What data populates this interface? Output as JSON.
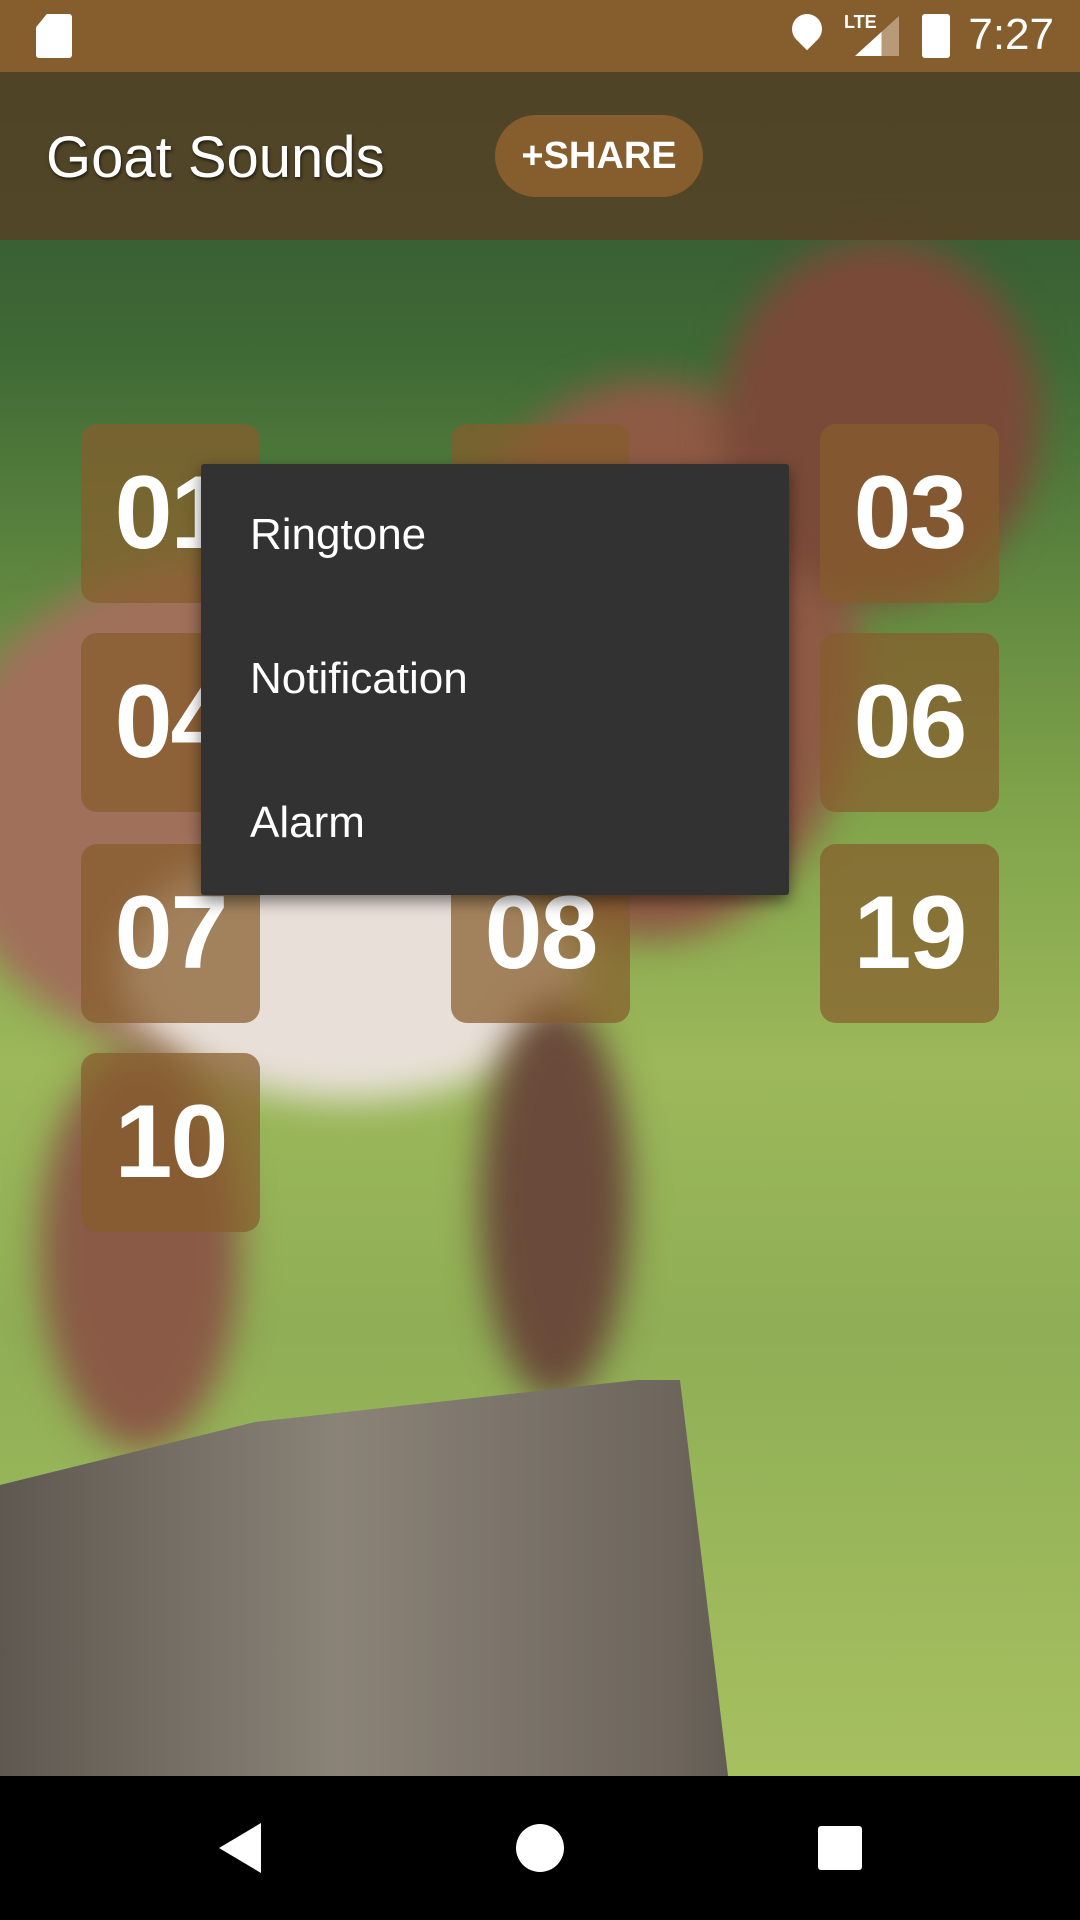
{
  "status_bar": {
    "time": "7:27",
    "network": "LTE",
    "icons": [
      "sd-card-icon",
      "location-icon",
      "lte-signal-icon",
      "battery-charging-icon"
    ],
    "color": "#865d2c"
  },
  "app_bar": {
    "title": "Goat Sounds",
    "share_label": "+SHARE"
  },
  "sound_buttons": [
    {
      "label": "01"
    },
    {
      "label": ""
    },
    {
      "label": "03"
    },
    {
      "label": "04"
    },
    {
      "label": ""
    },
    {
      "label": "06"
    },
    {
      "label": "07"
    },
    {
      "label": "08"
    },
    {
      "label": "19"
    },
    {
      "label": "10"
    }
  ],
  "popup_menu": {
    "items": [
      "Ringtone",
      "Notification",
      "Alarm"
    ]
  },
  "nav_bar": {
    "icons": [
      "back-icon",
      "home-icon",
      "recents-icon"
    ]
  },
  "colors": {
    "accent": "#865d2c",
    "menu_bg": "#323232"
  }
}
